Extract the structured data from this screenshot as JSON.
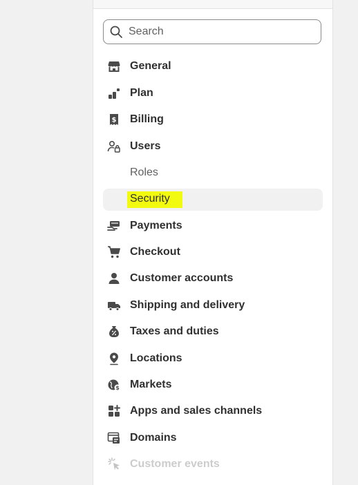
{
  "search": {
    "placeholder": "Search"
  },
  "nav": {
    "general": "General",
    "plan": "Plan",
    "billing": "Billing",
    "users": "Users",
    "roles": "Roles",
    "security": "Security",
    "payments": "Payments",
    "checkout": "Checkout",
    "customer_accounts": "Customer accounts",
    "shipping": "Shipping and delivery",
    "taxes": "Taxes and duties",
    "locations": "Locations",
    "markets": "Markets",
    "apps": "Apps and sales channels",
    "domains": "Domains",
    "customer_events": "Customer events"
  },
  "icons": {
    "general": "store-icon",
    "plan": "plan-icon",
    "billing": "receipt-icon",
    "users": "users-lock-icon",
    "payments": "payment-hand-icon",
    "checkout": "cart-icon",
    "customer_accounts": "person-icon",
    "shipping": "truck-icon",
    "taxes": "tax-bag-icon",
    "locations": "location-pin-icon",
    "markets": "globe-dollar-icon",
    "apps": "apps-icon",
    "domains": "domain-icon",
    "customer_events": "cursor-sparkle-icon"
  },
  "colors": {
    "text": "#303030",
    "subtext": "#616161",
    "disabled": "#cccccc",
    "highlight": "#f2fa10",
    "active_bg": "#f1f1f1"
  }
}
